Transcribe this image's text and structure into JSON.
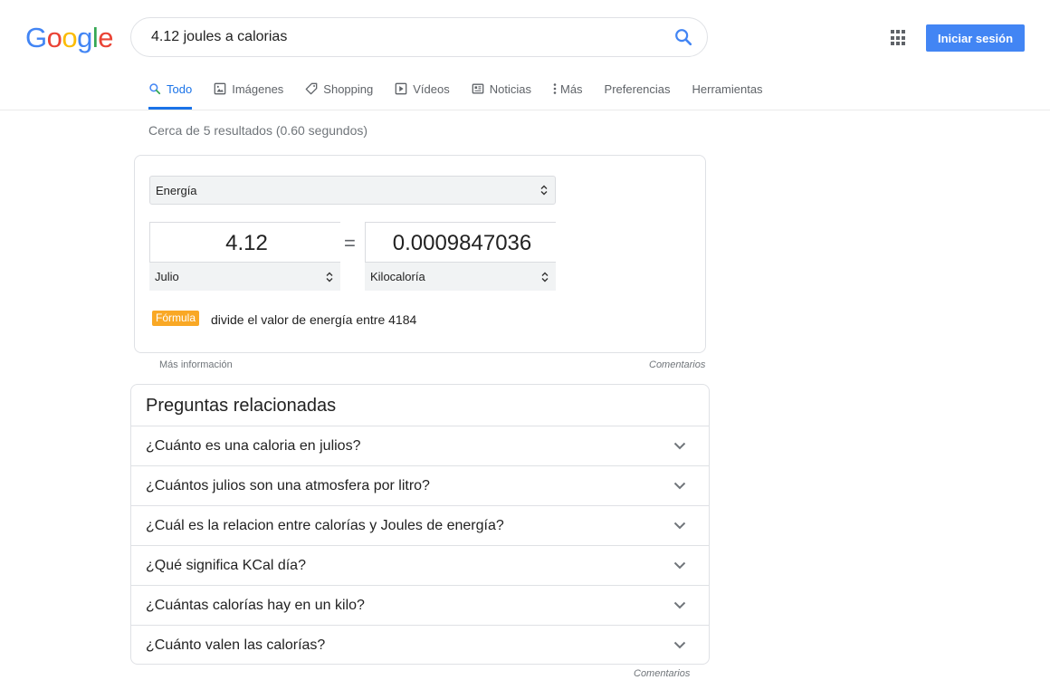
{
  "logo": {
    "letters": [
      "G",
      "o",
      "o",
      "g",
      "l",
      "e"
    ],
    "colors": [
      "#4285f4",
      "#ea4335",
      "#fbbc05",
      "#4285f4",
      "#34a853",
      "#ea4335"
    ]
  },
  "search": {
    "value": "4.12 joules a calorias"
  },
  "header": {
    "signin_label": "Iniciar sesión",
    "accent": "#4285f4"
  },
  "tabs": [
    {
      "label": "Todo",
      "icon": "search-icon",
      "active": true
    },
    {
      "label": "Imágenes",
      "icon": "image-icon"
    },
    {
      "label": "Shopping",
      "icon": "tag-icon"
    },
    {
      "label": "Vídeos",
      "icon": "play-icon"
    },
    {
      "label": "Noticias",
      "icon": "news-icon"
    },
    {
      "label": "Más",
      "icon": "more-vert-icon"
    },
    {
      "label": "Preferencias"
    },
    {
      "label": "Herramientas"
    }
  ],
  "stats": "Cerca de 5 resultados (0.60 segundos)",
  "converter": {
    "category": "Energía",
    "from_value": "4.12",
    "from_unit": "Julio",
    "to_value": "0.0009847036",
    "to_unit": "Kilocaloría",
    "equals": "=",
    "formula_label": "Fórmula",
    "formula_text": "divide el valor de energía entre 4184",
    "more_info": "Más información",
    "feedback": "Comentarios"
  },
  "related": {
    "title": "Preguntas relacionadas",
    "questions": [
      "¿Cuánto es una caloria en julios?",
      "¿Cuántos julios son una atmosfera por litro?",
      "¿Cuál es la relacion entre calorías y Joules de energía?",
      "¿Qué significa KCal día?",
      "¿Cuántas calorías hay en un kilo?",
      "¿Cuánto valen las calorías?"
    ],
    "feedback": "Comentarios"
  }
}
